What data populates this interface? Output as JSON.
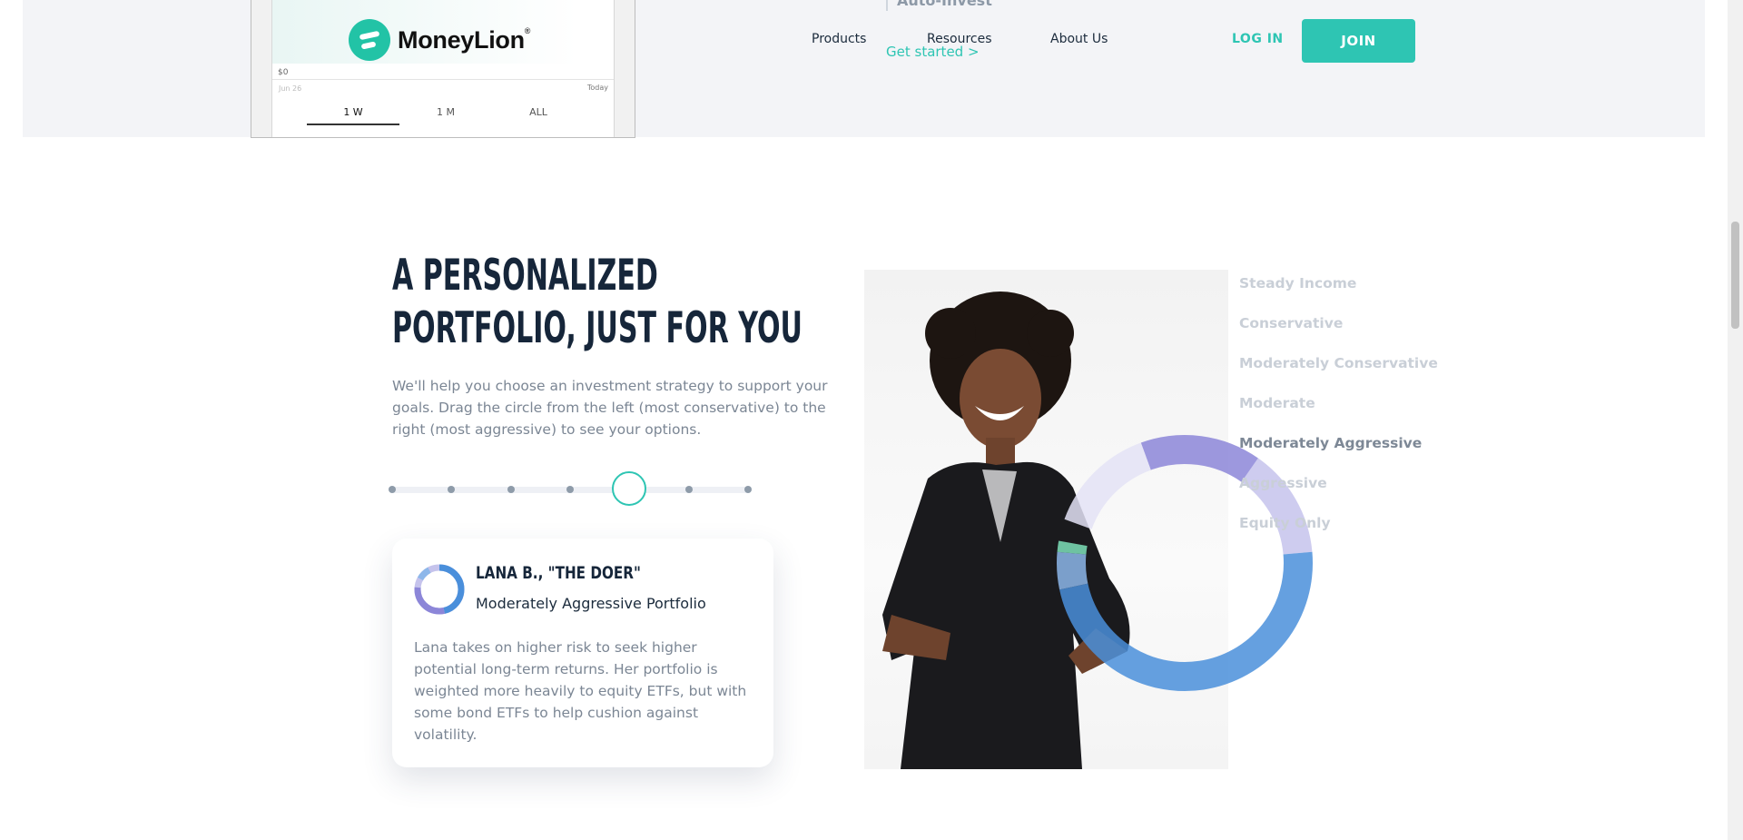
{
  "phone": {
    "brand": "MoneyLion",
    "brand_mark": "®",
    "axis_zero": "$0",
    "date_start": "Jun 26",
    "date_end": "Today",
    "tabs": [
      "1 W",
      "1 M",
      "ALL"
    ],
    "active_tab": "1 W"
  },
  "header": {
    "faded_heading": "Auto-Invest",
    "get_started": "Get started >",
    "nav": [
      "Products",
      "Resources",
      "About Us"
    ],
    "login": "LOG IN",
    "join": "JOIN"
  },
  "section": {
    "title_line1": "A PERSONALIZED",
    "title_line2": "PORTFOLIO, JUST FOR YOU",
    "intro": "We'll help you choose an investment strategy to support your goals. Drag the circle from the left (most conservative) to the right (most aggressive) to see your options."
  },
  "slider": {
    "stops": 7,
    "selected_index": 4
  },
  "card": {
    "name": "LANA B., \"THE DOER\"",
    "portfolio": "Moderately Aggressive Portfolio",
    "description": "Lana takes on higher risk to seek higher potential long-term returns. Her portfolio is weighted more heavily to equity ETFs, but with some bond ETFs to help cushion against volatility."
  },
  "options": [
    "Steady Income",
    "Conservative",
    "Moderately Conservative",
    "Moderate",
    "Moderately Aggressive",
    "Aggressive",
    "Equity Only"
  ],
  "selected_option": "Moderately Aggressive",
  "colors": {
    "accent": "#2ec5b3",
    "equity_blue": "#4a8fdb",
    "light_blue": "#8db7ea",
    "bond_purple": "#8c86d8",
    "lavender": "#c5c3ec",
    "mint": "#7ee0b8"
  }
}
